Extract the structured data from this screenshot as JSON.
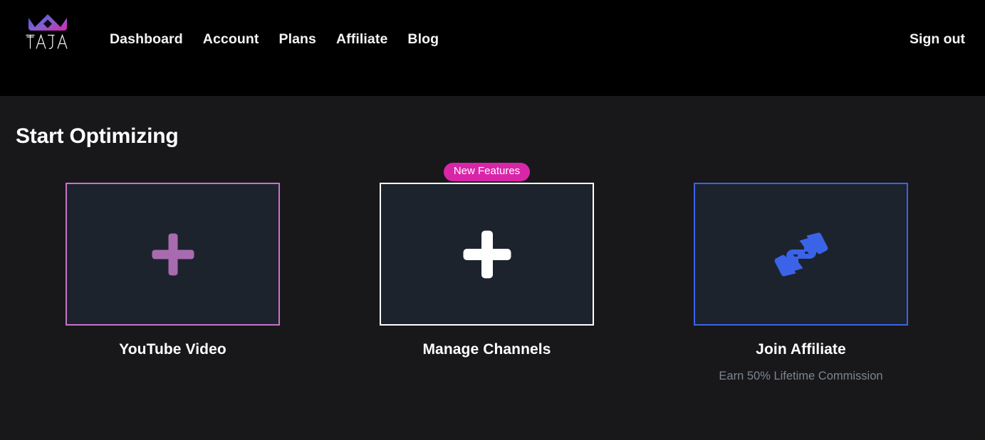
{
  "header": {
    "brand": {
      "name": "TAJA",
      "crown_icon": "crown-icon",
      "gradient_from": "#4f5bd5",
      "gradient_to": "#d926a9"
    },
    "nav": [
      {
        "label": "Dashboard",
        "name": "nav-item-dashboard"
      },
      {
        "label": "Account",
        "name": "nav-item-account"
      },
      {
        "label": "Plans",
        "name": "nav-item-plans"
      },
      {
        "label": "Affiliate",
        "name": "nav-item-affiliate"
      },
      {
        "label": "Blog",
        "name": "nav-item-blog"
      }
    ],
    "sign_out_label": "Sign out",
    "background": "#000000"
  },
  "main": {
    "title": "Start Optimizing",
    "background": "#18181b",
    "cards": [
      {
        "label": "YouTube Video",
        "sublabel": "",
        "badge": "",
        "icon": "plus-icon",
        "accent": "#c972c9",
        "tile_background": "#1d232d"
      },
      {
        "label": "Manage Channels",
        "sublabel": "",
        "badge": "New Features",
        "icon": "plus-icon",
        "accent": "#ffffff",
        "tile_background": "#1d232d"
      },
      {
        "label": "Join Affiliate",
        "sublabel": "Earn 50% Lifetime Commission",
        "badge": "",
        "icon": "handshake-icon",
        "accent": "#3b63e8",
        "tile_background": "#1d232d"
      }
    ]
  },
  "colors": {
    "badge_pink": "#d926a9",
    "accent_pink": "#c972c9",
    "accent_blue": "#3b63e8",
    "muted_text": "#7d8590"
  }
}
